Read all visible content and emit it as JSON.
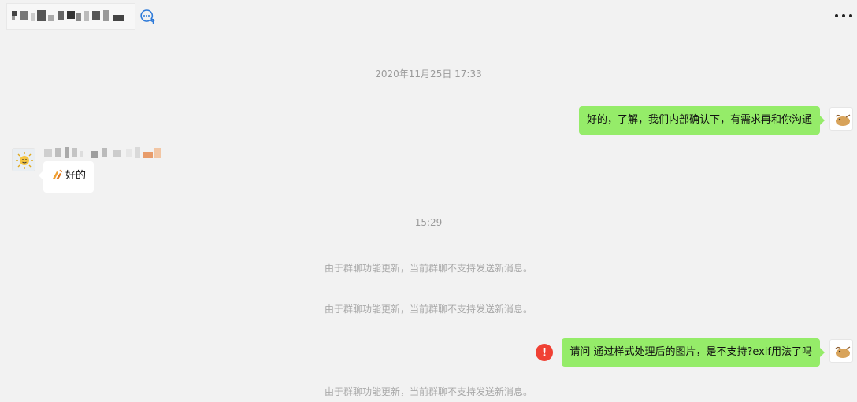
{
  "header": {
    "group_name": "",
    "more_label": "•••"
  },
  "chat": {
    "timestamps": [
      "2020年11月25日 17:33",
      "15:29"
    ],
    "messages": [
      {
        "direction": "sent",
        "text": "好的，了解，我们内部确认下，有需求再和你沟通"
      },
      {
        "direction": "received",
        "emoji": "clapping-hands-icon",
        "text": "好的"
      },
      {
        "direction": "sent",
        "text": "请问 通过样式处理后的图片，是不支持?exif用法了吗",
        "status": "failed"
      }
    ],
    "system_notices": [
      "由于群聊功能更新，当前群聊不支持发送新消息。",
      "由于群聊功能更新，当前群聊不支持发送新消息。",
      "由于群聊功能更新，当前群聊不支持发送新消息。"
    ],
    "error_symbol": "!"
  },
  "colors": {
    "sent_bubble": "#95ec69",
    "received_bubble": "#ffffff",
    "background": "#f2f2f2",
    "error": "#f04134"
  }
}
